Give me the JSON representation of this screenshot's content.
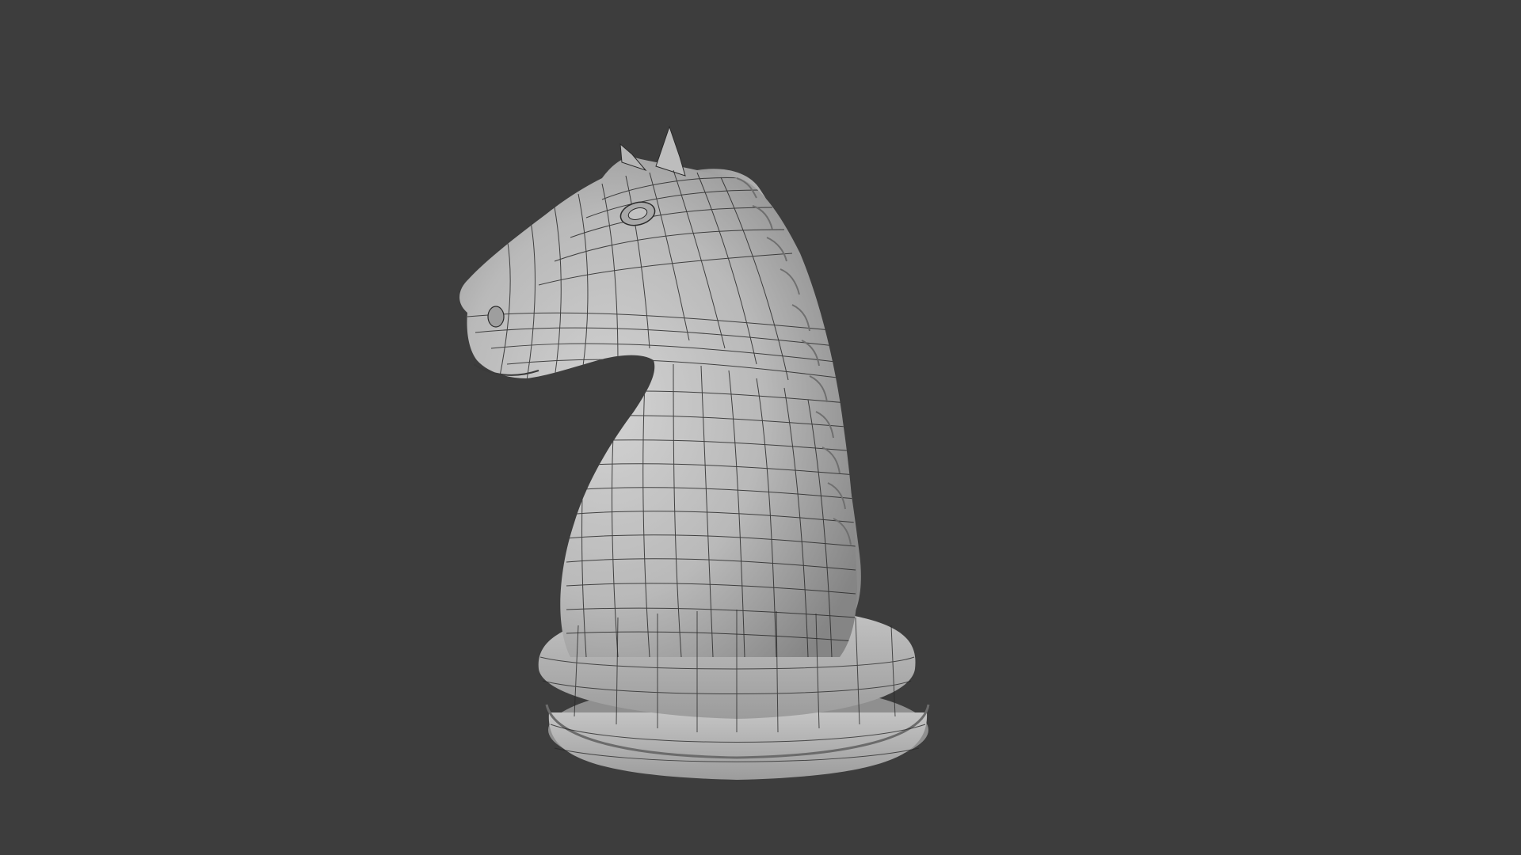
{
  "viewport": {
    "background_color": "#3d3d3d",
    "model": {
      "name": "knight-chess-piece",
      "shading": "solid-matcap-grey",
      "wireframe_overlay": true,
      "surface_color": "#c9c9c9",
      "wire_color": "#2a2a2a"
    }
  }
}
